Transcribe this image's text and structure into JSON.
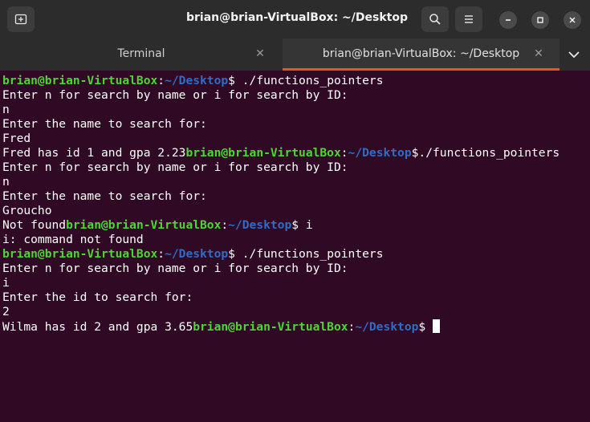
{
  "window": {
    "title": "brian@brian-VirtualBox: ~/Desktop",
    "controls": [
      "minimize-icon",
      "maximize-icon",
      "close-icon"
    ]
  },
  "tabs": [
    {
      "label": "Terminal",
      "active": false
    },
    {
      "label": "brian@brian-VirtualBox: ~/Desktop",
      "active": true
    }
  ],
  "colors": {
    "background": "#300a24",
    "prompt_user": "#4dd436",
    "prompt_path": "#2f6cc6",
    "text": "#ffffff",
    "accent": "#e95420"
  },
  "terminal": {
    "user": "brian@brian-VirtualBox",
    "sep": ":",
    "path": "~/Desktop",
    "dollar": "$",
    "lines": [
      " ./functions_pointers",
      "Enter n for search by name or i for search by ID:",
      "n",
      "Enter the name to search for:",
      "Fred",
      "Fred has id 1 and gpa 2.23",
      "./functions_pointers",
      "Enter n for search by name or i for search by ID:",
      "n",
      "Enter the name to search for:",
      "Groucho",
      "Not found",
      " i",
      "i: command not found",
      " ./functions_pointers",
      "Enter n for search by name or i for search by ID:",
      "i",
      "Enter the id to search for:",
      "2",
      "Wilma has id 2 and gpa 3.65",
      " "
    ]
  }
}
